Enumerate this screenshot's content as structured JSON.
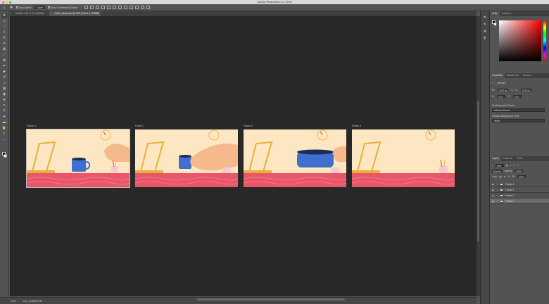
{
  "app": {
    "title": "Adobe Photoshop CC 2018",
    "traffic_colors": [
      "#ff5f57",
      "#febc2e",
      "#28c840"
    ]
  },
  "options_bar": {
    "auto_select": "Auto-Select:",
    "auto_select_target": "Layer",
    "show_transform": "Show Transform Controls"
  },
  "tabs": [
    {
      "label": "Untitled-1 @ 17.2% (RGB/8) *",
      "active": false
    },
    {
      "label": "Coffee_Break.psd @ 25% (Frame 1, RGB/8)",
      "active": true
    }
  ],
  "frames": [
    {
      "label": "Frame 1",
      "scene": "mug-on-table"
    },
    {
      "label": "Frame 2",
      "scene": "hand-lifts-mug"
    },
    {
      "label": "Frame 3",
      "scene": "mug-close-up"
    },
    {
      "label": "Frame 4",
      "scene": "empty-table"
    }
  ],
  "status": {
    "zoom": "25%",
    "doc": "Doc: 14.8M/93.9M"
  },
  "color_panel": {
    "tabs": [
      "Color",
      "Swatches"
    ]
  },
  "properties_panel": {
    "tabs": [
      "Properties",
      "Adjustments",
      "Libraries"
    ],
    "type_label": "Artboard",
    "w_label": "W:",
    "w_value": "1920 px",
    "h_label": "H:",
    "h_value": "1080 px",
    "x_label": "X:",
    "x_value": "0 px",
    "y_label": "Y:",
    "y_value": "0 px",
    "set_artboard_label": "Set Artboard to Preset:",
    "set_artboard_value": "Artboard Preset",
    "bg_color_label": "Artboard Background Color:",
    "bg_color_value": "White"
  },
  "layers_panel": {
    "tabs": [
      "Layers",
      "Channels",
      "Paths"
    ],
    "kind_label": "Kind",
    "blend_mode": "Normal",
    "opacity_label": "Opacity:",
    "opacity_value": "100%",
    "lock_label": "Lock:",
    "fill_label": "Fill:",
    "fill_value": "100%",
    "layers": [
      {
        "name": "Frame 4",
        "selected": false
      },
      {
        "name": "Frame 3",
        "selected": false
      },
      {
        "name": "Frame 2",
        "selected": false
      },
      {
        "name": "Frame 1",
        "selected": true
      }
    ]
  },
  "scene_colors": {
    "wall": "#fce7c2",
    "table": "#e9566a",
    "mug": "#3f6fcf",
    "laptop": "#e7b13a",
    "hand": "#f6b98c",
    "clock": "#e7b13a"
  }
}
